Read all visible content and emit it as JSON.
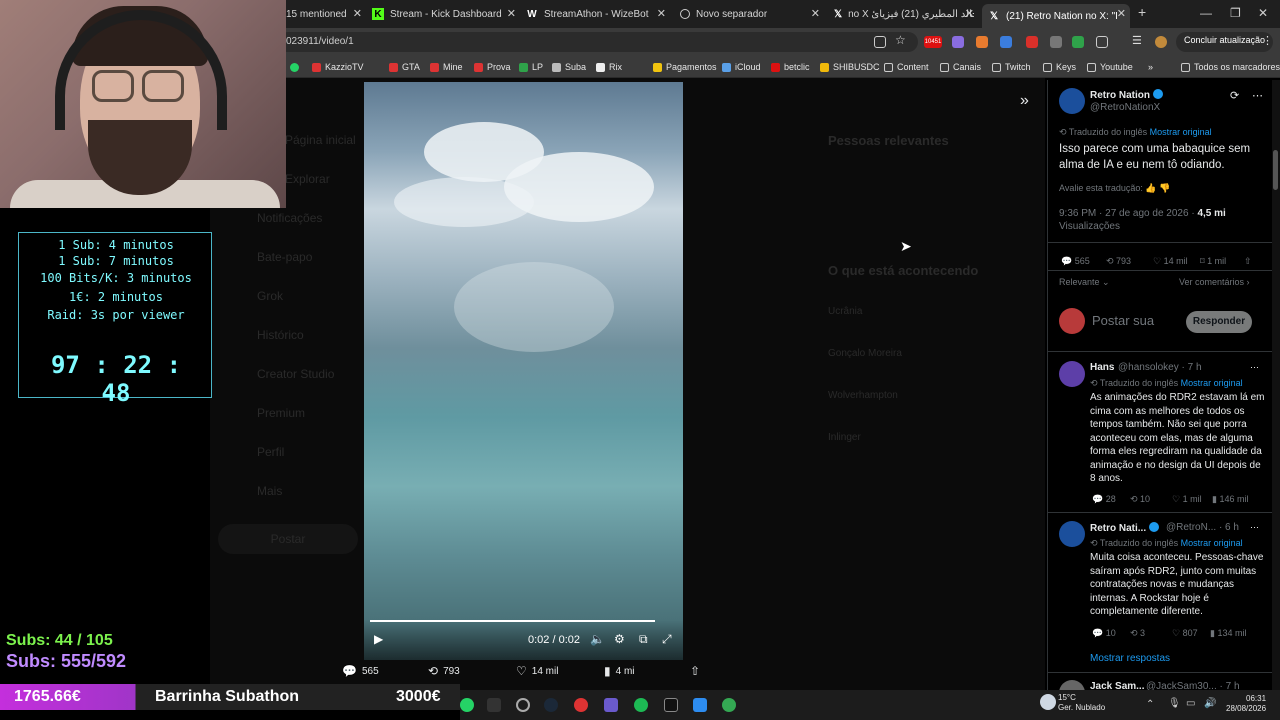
{
  "browser": {
    "tabs": [
      {
        "label": "15 mentioned",
        "active": false
      },
      {
        "label": "Stream - Kick Dashboard",
        "active": false
      },
      {
        "label": "StreamAthon - WizeBot",
        "active": false
      },
      {
        "label": "Novo separador",
        "active": false
      },
      {
        "label": "no X خالد المطيري (21) فيزيائ",
        "active": false
      },
      {
        "label": "(21) Retro Nation no X: \"I",
        "active": true
      }
    ],
    "url": "023911/video/1",
    "update_label": "Concluir atualização",
    "bookmarks": [
      "KazzioTV",
      "GTA",
      "Mine",
      "Prova",
      "LP",
      "Suba",
      "Rix",
      "Pagamentos",
      "iCloud",
      "betclic",
      "SHIBUSDC",
      "Content",
      "Canais",
      "Twitch",
      "Keys",
      "Youtube"
    ],
    "all_bookmarks": "Todos os marcadores",
    "badge_number": "10451"
  },
  "overlay": {
    "sub_lines": [
      "1 Sub: 4 minutos",
      "1 Sub: 7 minutos",
      "100 Bits/K: 3 minutos",
      "1€: 2 minutos",
      "Raid: 3s por viewer"
    ],
    "timer": "97 : 22 : 48",
    "subs_count": "Subs: 44 / 105",
    "subs_total": "Subs: 555/592",
    "bar_left": "1765.66€",
    "bar_title": "Barrinha Subathon",
    "bar_right": "3000€"
  },
  "background_page": {
    "nav": [
      "Página inicial",
      "Explorar",
      "Notificações",
      "Bate-papo",
      "Grok",
      "Histórico",
      "Creator Studio",
      "Premium",
      "Perfil",
      "Mais"
    ],
    "post_button": "Postar",
    "relevant_title": "Pessoas relevantes",
    "happening_title": "O que está acontecendo",
    "trends": [
      "Ucrânia",
      "Gonçalo Moreira",
      "Wolverhampton",
      "Inlinger"
    ]
  },
  "video": {
    "time": "0:02 / 0:02",
    "progress": 1.0
  },
  "video_stats": {
    "replies": "565",
    "reposts": "793",
    "likes": "14 mil",
    "views": "4 mi"
  },
  "post": {
    "name": "Retro Nation",
    "handle": "@RetroNationX",
    "translated_label": "Traduzido do inglês",
    "show_original": "Mostrar original",
    "text": "Isso parece com uma babaquice sem alma de IA e eu nem tô odiando.",
    "rate_translation": "Avalie esta tradução:",
    "timestamp": "9:36 PM · 27 de ago de 2026 ·",
    "views_value": "4,5 mi",
    "views_label": "Visualizações",
    "replies": "565",
    "reposts": "793",
    "likes": "14 mil",
    "bookmarks": "1 mil",
    "sort": "Relevante",
    "see_comments": "Ver comentários",
    "reply_placeholder": "Postar sua",
    "reply_button": "Responder"
  },
  "replies": [
    {
      "name": "Hans",
      "handle": "@hansolokey · 7 h",
      "translated": "Traduzido do inglês",
      "show_original": "Mostrar original",
      "text": "As animações do RDR2 estavam lá em cima com as melhores de todos os tempos também. Não sei que porra aconteceu com elas, mas de alguma forma eles regrediram na qualidade da animação e no design da UI depois de 8 anos.",
      "replies": "28",
      "reposts": "10",
      "likes": "1 mil",
      "views": "146 mil"
    },
    {
      "name": "Retro Nati...",
      "handle": "@RetroN... · 6 h",
      "translated": "Traduzido do inglês",
      "show_original": "Mostrar original",
      "text": "Muita coisa aconteceu. Pessoas-chave saíram após RDR2, junto com muitas contratações novas e mudanças internas. A Rockstar hoje é completamente diferente.",
      "replies": "10",
      "reposts": "3",
      "likes": "807",
      "views": "134 mil"
    }
  ],
  "show_replies": "Mostrar respostas",
  "next_reply": {
    "name": "Jack Sam...",
    "handle": "@JackSam30... · 7 h"
  },
  "taskbar": {
    "weather_temp": "15°C",
    "weather_desc": "Ger. Nublado",
    "time": "06:31",
    "date": "28/08/2026"
  },
  "colors": {
    "accent": "#1d9bf0",
    "timer": "#7ffaff",
    "subs_green": "#7cf24d",
    "subs_purple": "#c08bff",
    "bar_fill": "#c42fdc"
  },
  "subathon_progress": 0.59
}
